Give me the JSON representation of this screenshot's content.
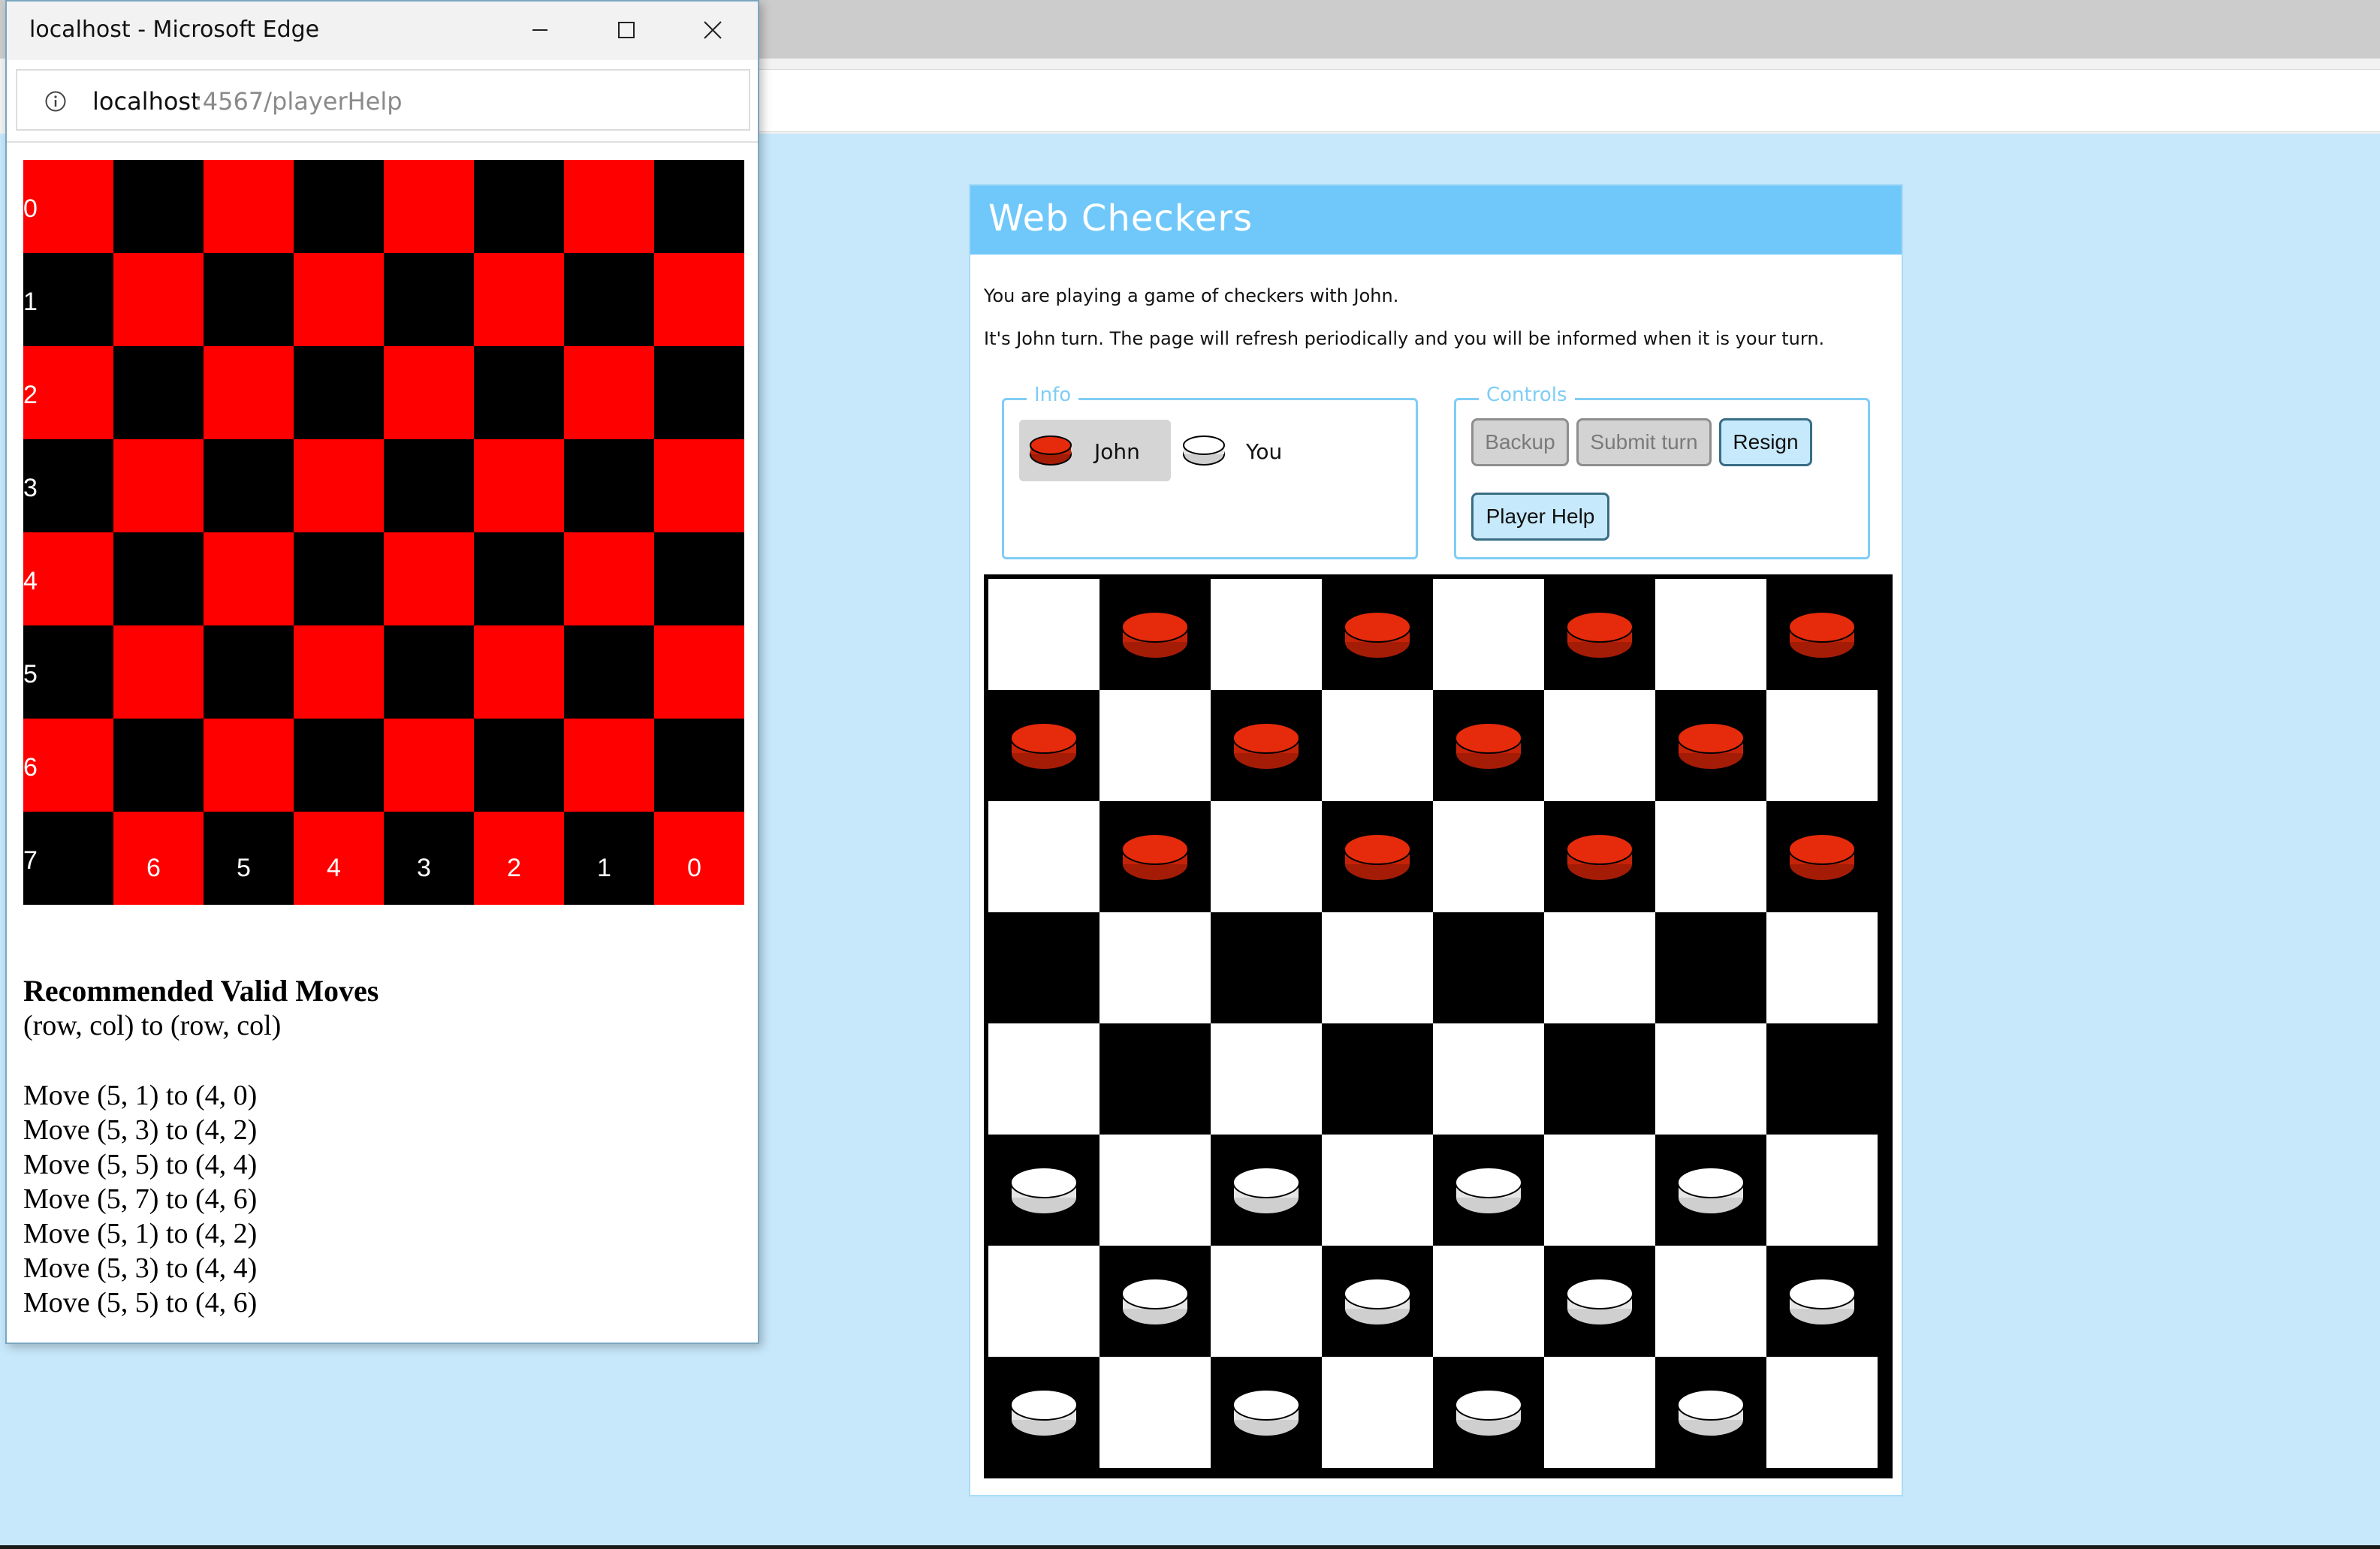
{
  "popup": {
    "title": "localhost - Microsoft Edge",
    "url_host": "localhost",
    "url_path": ":4567/playerHelp",
    "board": {
      "row_labels": [
        "0",
        "1",
        "2",
        "3",
        "4",
        "5",
        "6",
        "7"
      ],
      "col_labels": [
        "6",
        "5",
        "4",
        "3",
        "2",
        "1",
        "0"
      ],
      "colors": {
        "red": "#ff0000",
        "black": "#000000"
      }
    },
    "moves_title": "Recommended Valid Moves",
    "moves_subtitle": "(row, col) to (row, col)",
    "moves": [
      "Move (5, 1) to (4, 0)",
      "Move (5, 3) to (4, 2)",
      "Move (5, 5) to (4, 4)",
      "Move (5, 7) to (4, 6)",
      "Move (5, 1) to (4, 2)",
      "Move (5, 3) to (4, 4)",
      "Move (5, 5) to (4, 6)"
    ]
  },
  "game": {
    "title": "Web Checkers",
    "message1": "You are playing a game of checkers with John.",
    "message2": "It's John turn. The page will refresh periodically and you will be informed when it is your turn.",
    "info_legend": "Info",
    "controls_legend": "Controls",
    "player_red": "John",
    "player_white": "You",
    "buttons": {
      "backup": "Backup",
      "submit": "Submit turn",
      "resign": "Resign",
      "help": "Player Help"
    },
    "board": [
      [
        "",
        "r",
        "",
        "r",
        "",
        "r",
        "",
        "r"
      ],
      [
        "r",
        "",
        "r",
        "",
        "r",
        "",
        "r",
        ""
      ],
      [
        "",
        "r",
        "",
        "r",
        "",
        "r",
        "",
        "r"
      ],
      [
        "",
        "",
        "",
        "",
        "",
        "",
        "",
        ""
      ],
      [
        "",
        "",
        "",
        "",
        "",
        "",
        "",
        ""
      ],
      [
        "w",
        "",
        "w",
        "",
        "w",
        "",
        "w",
        ""
      ],
      [
        "",
        "w",
        "",
        "w",
        "",
        "w",
        "",
        "w"
      ],
      [
        "w",
        "",
        "w",
        "",
        "w",
        "",
        "w",
        ""
      ]
    ],
    "colors": {
      "header": "#6fc8f9",
      "background": "#c7e8fb",
      "red_piece": "#e52b0b",
      "white_piece": "#ffffff"
    }
  }
}
